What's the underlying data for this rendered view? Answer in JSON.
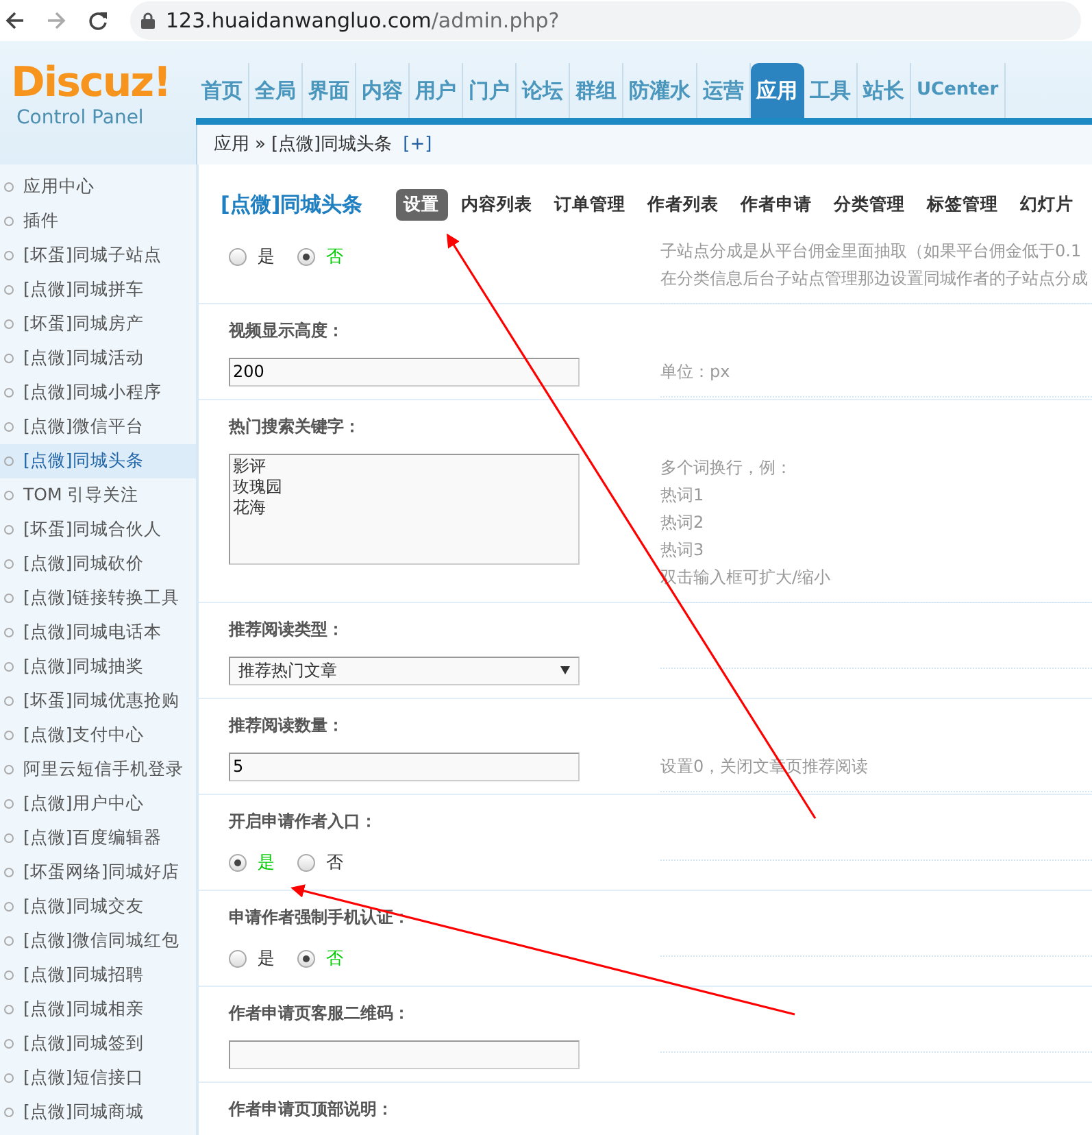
{
  "browser": {
    "url_host": "123.huaidanwangluo.com",
    "url_path": "/admin.php?"
  },
  "header": {
    "logo": "Discuz!",
    "logo_subtitle": "Control Panel",
    "nav": [
      {
        "label": "首页",
        "selected": false
      },
      {
        "label": "全局",
        "selected": false
      },
      {
        "label": "界面",
        "selected": false
      },
      {
        "label": "内容",
        "selected": false
      },
      {
        "label": "用户",
        "selected": false
      },
      {
        "label": "门户",
        "selected": false
      },
      {
        "label": "论坛",
        "selected": false
      },
      {
        "label": "群组",
        "selected": false
      },
      {
        "label": "防灌水",
        "selected": false
      },
      {
        "label": "运营",
        "selected": false
      },
      {
        "label": "应用",
        "selected": true
      },
      {
        "label": "工具",
        "selected": false
      },
      {
        "label": "站长",
        "selected": false
      },
      {
        "label": "UCenter",
        "selected": false
      }
    ]
  },
  "breadcrumb": {
    "items": [
      "应用",
      "»",
      "[点微]同城头条"
    ],
    "add_link": "[+]"
  },
  "sidebar": {
    "items": [
      {
        "label": "应用中心",
        "selected": false
      },
      {
        "label": "插件",
        "selected": false
      },
      {
        "label": "[坏蛋]同城子站点",
        "selected": false
      },
      {
        "label": "[点微]同城拼车",
        "selected": false
      },
      {
        "label": "[坏蛋]同城房产",
        "selected": false
      },
      {
        "label": "[点微]同城活动",
        "selected": false
      },
      {
        "label": "[点微]同城小程序",
        "selected": false
      },
      {
        "label": "[点微]微信平台",
        "selected": false
      },
      {
        "label": "[点微]同城头条",
        "selected": true
      },
      {
        "label": "TOM 引导关注",
        "selected": false
      },
      {
        "label": "[坏蛋]同城合伙人",
        "selected": false
      },
      {
        "label": "[点微]同城砍价",
        "selected": false
      },
      {
        "label": "[点微]链接转换工具",
        "selected": false
      },
      {
        "label": "[点微]同城电话本",
        "selected": false
      },
      {
        "label": "[点微]同城抽奖",
        "selected": false
      },
      {
        "label": "[坏蛋]同城优惠抢购",
        "selected": false
      },
      {
        "label": "[点微]支付中心",
        "selected": false
      },
      {
        "label": "阿里云短信手机登录",
        "selected": false
      },
      {
        "label": "[点微]用户中心",
        "selected": false
      },
      {
        "label": "[点微]百度编辑器",
        "selected": false
      },
      {
        "label": "[坏蛋网络]同城好店",
        "selected": false
      },
      {
        "label": "[点微]同城交友",
        "selected": false
      },
      {
        "label": "[点微]微信同城红包",
        "selected": false
      },
      {
        "label": "[点微]同城招聘",
        "selected": false
      },
      {
        "label": "[点微]同城相亲",
        "selected": false
      },
      {
        "label": "[点微]同城签到",
        "selected": false
      },
      {
        "label": "[点微]短信接口",
        "selected": false
      },
      {
        "label": "[点微]同城商城",
        "selected": false
      }
    ]
  },
  "plugin": {
    "title": "[点微]同城头条",
    "tabs": [
      {
        "label": "设置",
        "selected": true
      },
      {
        "label": "内容列表",
        "selected": false
      },
      {
        "label": "订单管理",
        "selected": false
      },
      {
        "label": "作者列表",
        "selected": false
      },
      {
        "label": "作者申请",
        "selected": false
      },
      {
        "label": "分类管理",
        "selected": false
      },
      {
        "label": "标签管理",
        "selected": false
      },
      {
        "label": "幻灯片",
        "selected": false
      }
    ]
  },
  "settings": [
    {
      "kind": "radio",
      "options": [
        {
          "label": "是",
          "selected": false
        },
        {
          "label": "否",
          "selected": true
        }
      ],
      "notes": [
        "子站点分成是从平台佣金里面抽取（如果平台佣金低于0.1",
        "在分类信息后台子站点管理那边设置同城作者的子站点分成"
      ]
    },
    {
      "kind": "text",
      "label": "视频显示高度：",
      "value": "200",
      "notes": [
        "单位：px"
      ]
    },
    {
      "kind": "textarea",
      "label": "热门搜索关键字：",
      "lines": [
        "影评",
        "玫瑰园",
        "花海"
      ],
      "notes": [
        "多个词换行，例：",
        "热词1",
        "热词2",
        "热词3",
        "双击输入框可扩大/缩小"
      ]
    },
    {
      "kind": "select",
      "label": "推荐阅读类型：",
      "value": "推荐热门文章"
    },
    {
      "kind": "text",
      "label": "推荐阅读数量：",
      "value": "5",
      "notes": [
        "设置0，关闭文章页推荐阅读"
      ]
    },
    {
      "kind": "radio",
      "label": "开启申请作者入口：",
      "options": [
        {
          "label": "是",
          "selected": true
        },
        {
          "label": "否",
          "selected": false
        }
      ]
    },
    {
      "kind": "radio",
      "label": "申请作者强制手机认证：",
      "options": [
        {
          "label": "是",
          "selected": false
        },
        {
          "label": "否",
          "selected": true
        }
      ]
    },
    {
      "kind": "text",
      "label": "作者申请页客服二维码："
    },
    {
      "kind": "label",
      "label": "作者申请页顶部说明："
    }
  ]
}
